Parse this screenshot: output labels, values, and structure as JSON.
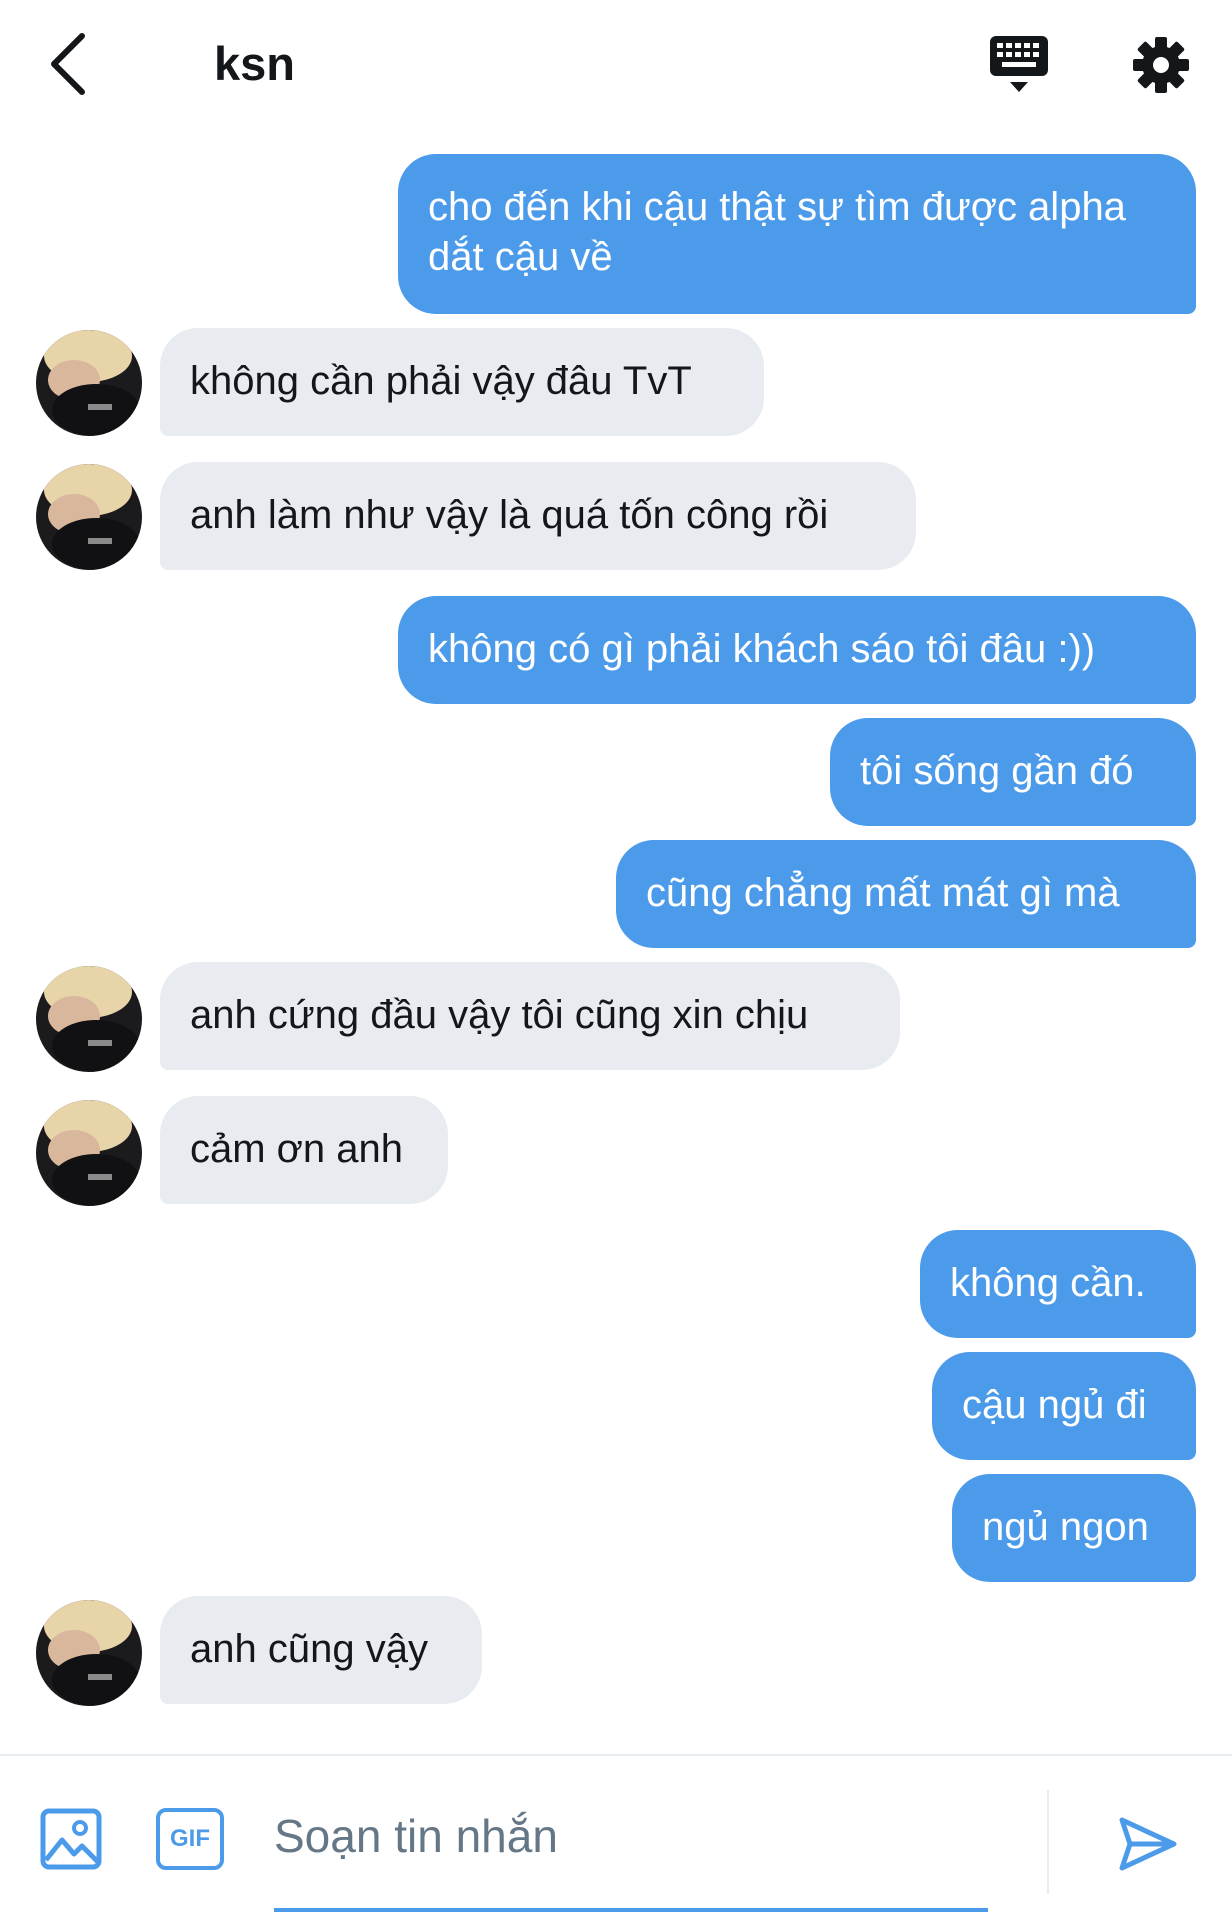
{
  "header": {
    "title": "ksn",
    "back_icon": "chevron-left-icon",
    "keyboard_icon": "keyboard-icon",
    "settings_icon": "gear-icon"
  },
  "colors": {
    "accent": "#4c9bea",
    "received_bubble": "#e8ecf1",
    "text": "#14171a",
    "muted": "#657786"
  },
  "messages": [
    {
      "sender": "me",
      "text": "cho đến khi cậu thật sự tìm được alpha dắt cậu về"
    },
    {
      "sender": "ksn",
      "text": "không cần phải vậy đâu TvT"
    },
    {
      "sender": "ksn",
      "text": "anh làm như vậy là quá tốn công rồi"
    },
    {
      "sender": "me",
      "text": "không có gì phải khách sáo tôi đâu :))"
    },
    {
      "sender": "me",
      "text": "tôi sống gần đó"
    },
    {
      "sender": "me",
      "text": "cũng chẳng mất mát gì mà"
    },
    {
      "sender": "ksn",
      "text": "anh cứng đầu vậy tôi cũng xin chịu"
    },
    {
      "sender": "ksn",
      "text": "cảm ơn anh"
    },
    {
      "sender": "me",
      "text": "không cần."
    },
    {
      "sender": "me",
      "text": "cậu ngủ đi"
    },
    {
      "sender": "me",
      "text": "ngủ ngon"
    },
    {
      "sender": "ksn",
      "text": "anh cũng vậy"
    }
  ],
  "composer": {
    "placeholder": "Soạn tin nhắn",
    "value": "",
    "gif_label": "GIF",
    "media_icon": "image-icon",
    "send_icon": "send-icon"
  }
}
